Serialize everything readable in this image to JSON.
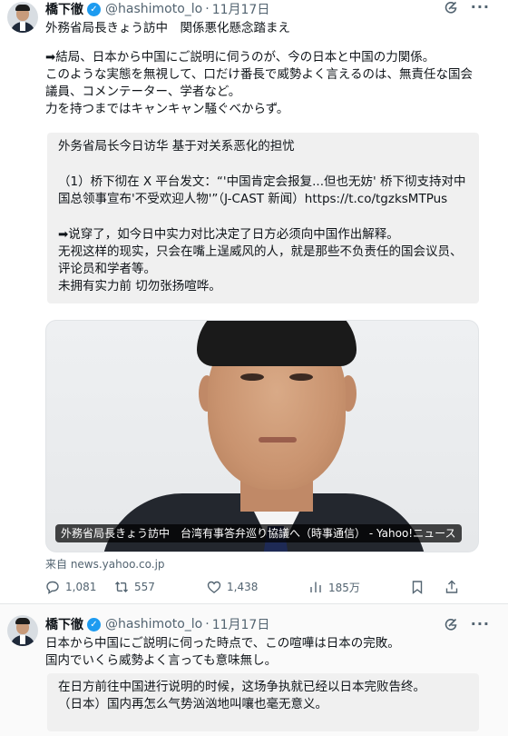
{
  "tweet1": {
    "author_name": "橋下徹",
    "handle": "@hashimoto_lo",
    "separator": "·",
    "date": "11月17日",
    "title": "外務省局長きょう訪中　関係悪化懸念踏まえ",
    "paragraph": "➡結局、日本から中国にご説明に伺うのが、今の日本と中国の力関係。\nこのような実態を無視して、口だけ番長で威勢よく言えるのは、無責任な国会議員、コメンテーター、学者など。\n力を持つまではキャンキャン騒ぐべからず。",
    "translation": {
      "title": "外务省局长今日访华 基于对关系恶化的担忧",
      "line1": "（1）桥下彻在 X 平台发文：“'中国肯定会报复...但也无妨' 桥下彻支持对中国总领事宣布'不受欢迎人物'”（J-CAST 新闻）https://t.co/tgzksMTPus",
      "line2": "➡说穿了，如今日中实力对比决定了日方必须向中国作出解释。\n无视这样的现实，只会在嘴上逞威风的人，就是那些不负责任的国会议员、评论员和学者等。\n未拥有实力前 切勿张扬喧哗。"
    },
    "media": {
      "caption": "外務省局長きょう訪中　台湾有事答弁巡り協議へ（時事通信） - Yahoo!ニュース"
    },
    "source": "来自 news.yahoo.co.jp",
    "stats": {
      "replies": "1,081",
      "reposts": "557",
      "likes": "1,438",
      "views": "185万"
    }
  },
  "tweet2": {
    "author_name": "橋下徹",
    "handle": "@hashimoto_lo",
    "separator": "·",
    "date": "11月17日",
    "text": "日本から中国にご説明に伺った時点で、この喧嘩は日本の完敗。\n国内でいくら威勢よく言っても意味無し。",
    "translation": "在日方前往中国进行说明的时候，这场争执就已经以日本完败告终。\n（日本）国内再怎么气势汹汹地叫嚷也毫无意义。"
  },
  "icons": {
    "verified": "verified-badge-icon",
    "grok": "grok-icon",
    "more": "more-icon",
    "reply": "reply-icon",
    "repost": "repost-icon",
    "like": "like-icon",
    "views": "views-icon",
    "bookmark": "bookmark-icon",
    "share": "share-icon"
  },
  "colors": {
    "accent": "#1d9bf0",
    "text": "#0f1419",
    "muted": "#536471",
    "translation_bg": "#f0f0f0"
  }
}
